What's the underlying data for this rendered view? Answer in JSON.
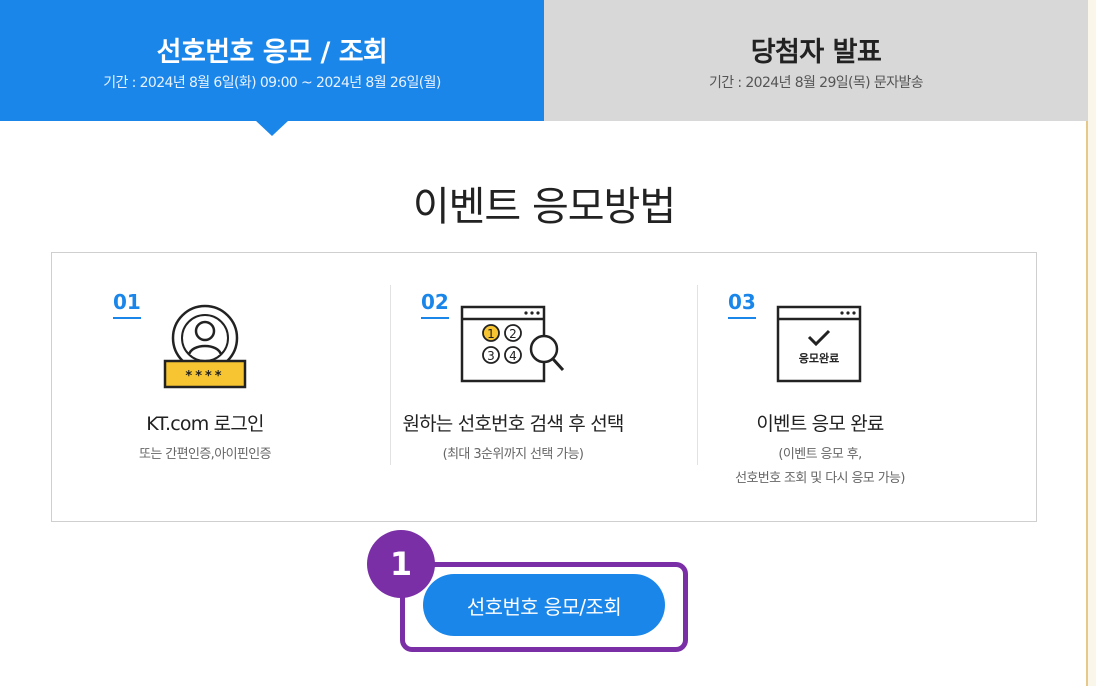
{
  "tabs": [
    {
      "title": "선호번호 응모 / 조회",
      "period": "기간 : 2024년 8월 6일(화) 09:00 ~ 2024년 8월 26일(월)",
      "active": true
    },
    {
      "title": "당첨자 발표",
      "period": "기간 : 2024년 8월 29일(목) 문자발송",
      "active": false
    }
  ],
  "section": {
    "title": "이벤트 응모방법"
  },
  "steps": [
    {
      "num": "01",
      "title": "KT.com 로그인",
      "desc": "또는 간편인증,아이핀인증",
      "icon": "user-login-icon",
      "icon_text": "****"
    },
    {
      "num": "02",
      "title": "원하는 선호번호 검색 후 선택",
      "desc": "(최대 3순위까지 선택 가능)",
      "icon": "number-search-icon",
      "icon_text": [
        "1",
        "2",
        "3",
        "4"
      ]
    },
    {
      "num": "03",
      "title": "이벤트 응모 완료",
      "desc": "(이벤트 응모 후,\n선호번호 조회 및 다시 응모 가능)",
      "icon": "apply-complete-icon",
      "icon_text": "응모완료"
    }
  ],
  "cta": {
    "label": "선호번호 응모/조회",
    "badge": "1"
  },
  "colors": {
    "primary": "#1a86ea",
    "tab_inactive": "#d8d8d8",
    "highlight": "#7a2fa6",
    "key_yellow": "#f7c531"
  }
}
